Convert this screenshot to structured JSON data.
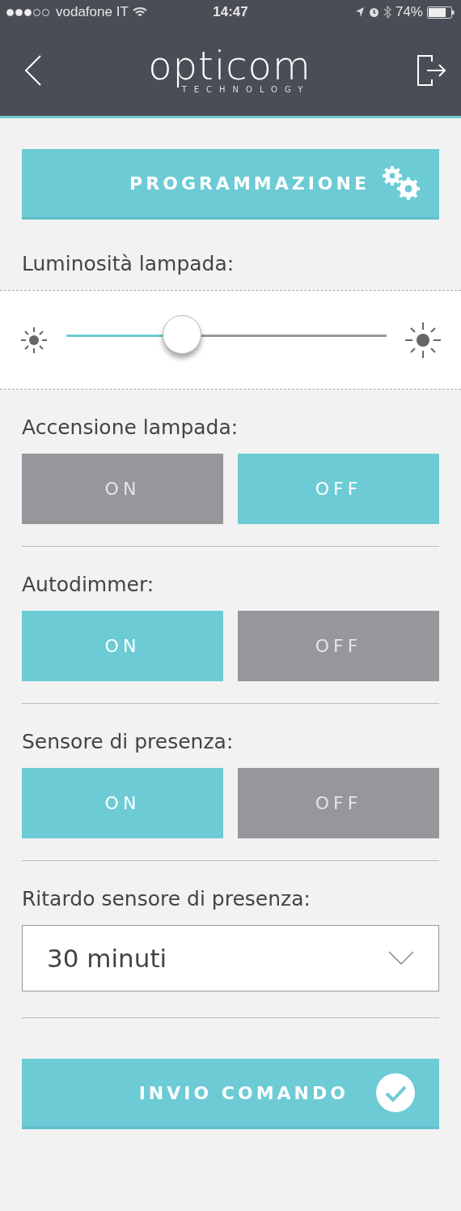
{
  "status_bar": {
    "carrier": "vodafone IT",
    "signal_dots": [
      {
        "on": true
      },
      {
        "on": true
      },
      {
        "on": true
      },
      {
        "on": false
      },
      {
        "on": false
      }
    ],
    "time": "14:47",
    "battery": "74%"
  },
  "header": {
    "logo": "opticom",
    "tagline": "TECHNOLOGY"
  },
  "program_button": {
    "label": "PROGRAMMAZIONE"
  },
  "brightness": {
    "label": "Luminosità lampada:",
    "level": 0.36
  },
  "toggles": [
    {
      "label": "Accensione lampada:",
      "options": [
        {
          "label": "ON",
          "selected": false
        },
        {
          "label": "OFF",
          "selected": true
        }
      ]
    },
    {
      "label": "Autodimmer:",
      "options": [
        {
          "label": "ON",
          "selected": true
        },
        {
          "label": "OFF",
          "selected": false
        }
      ]
    },
    {
      "label": "Sensore di presenza:",
      "options": [
        {
          "label": "ON",
          "selected": true
        },
        {
          "label": "OFF",
          "selected": false
        }
      ]
    }
  ],
  "delay": {
    "label": "Ritardo sensore di presenza:",
    "value": "30 minuti"
  },
  "send_button": {
    "label": "INVIO COMANDO"
  }
}
